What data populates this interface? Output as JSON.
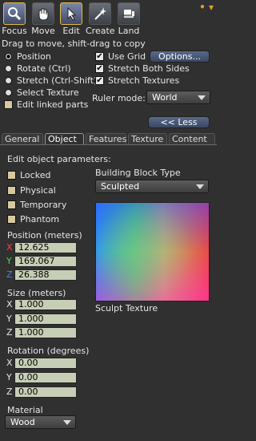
{
  "toolbar": {
    "tools": [
      {
        "label": "Focus",
        "icon": "magnifier-icon"
      },
      {
        "label": "Move",
        "icon": "hand-icon"
      },
      {
        "label": "Edit",
        "icon": "pointer-icon"
      },
      {
        "label": "Create",
        "icon": "wand-icon"
      },
      {
        "label": "Land",
        "icon": "bulldozer-icon"
      }
    ],
    "menu_glyph": "• ▾"
  },
  "hint": "Drag to move, shift-drag to copy",
  "modes": [
    "Position",
    "Rotate (Ctrl)",
    "Stretch (Ctrl-Shift)",
    "Select Texture"
  ],
  "edit_linked_parts": "Edit linked parts",
  "options": {
    "use_grid": "Use Grid",
    "options_button": "Options...",
    "stretch_both_sides": "Stretch Both Sides",
    "stretch_textures": "Stretch Textures",
    "ruler_mode_label": "Ruler mode:",
    "ruler_mode_value": "World",
    "less_button": "<< Less"
  },
  "tabs": [
    "General",
    "Object",
    "Features",
    "Texture",
    "Content"
  ],
  "object": {
    "heading": "Edit object parameters:",
    "flags": [
      "Locked",
      "Physical",
      "Temporary",
      "Phantom"
    ],
    "position_label": "Position (meters)",
    "position": {
      "x": "12.625",
      "y": "169.067",
      "z": "26.388"
    },
    "size_label": "Size (meters)",
    "size": {
      "x": "1.000",
      "y": "1.000",
      "z": "1.000"
    },
    "rotation_label": "Rotation (degrees)",
    "rotation": {
      "x": "0.00",
      "y": "0.00",
      "z": "0.00"
    },
    "material_label": "Material",
    "material_value": "Wood",
    "block_type_label": "Building Block Type",
    "block_type_value": "Sculpted",
    "sculpt_texture_label": "Sculpt Texture"
  },
  "axis_labels": {
    "x": "X",
    "y": "Y",
    "z": "Z"
  },
  "colors": {
    "x_axis": "#ff4040",
    "y_axis": "#40e040",
    "z_axis": "#4080ff",
    "selected_tool_border": "#e6b84a"
  }
}
